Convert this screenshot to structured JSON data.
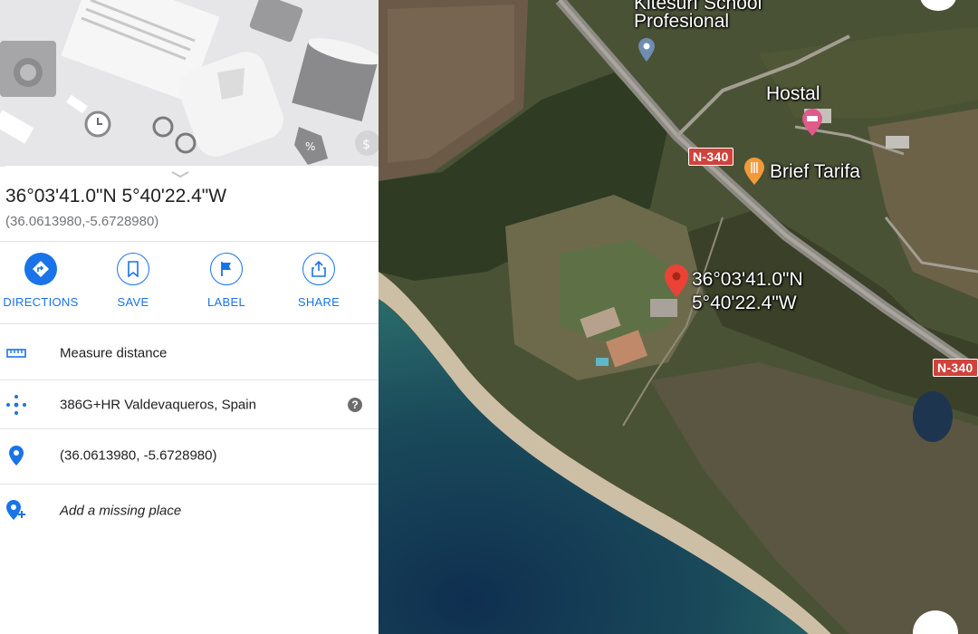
{
  "place": {
    "title": "36°03'41.0\"N 5°40'22.4\"W",
    "decimal": "(36.0613980,-5.6728980)"
  },
  "actions": [
    {
      "label": "DIRECTIONS",
      "icon": "directions-icon"
    },
    {
      "label": "SAVE",
      "icon": "bookmark-icon"
    },
    {
      "label": "LABEL",
      "icon": "flag-icon"
    },
    {
      "label": "SHARE",
      "icon": "share-icon"
    }
  ],
  "details": {
    "measure": "Measure distance",
    "plus_code": "386G+HR Valdevaqueros, Spain",
    "coords": "(36.0613980, -5.6728980)",
    "add_place": "Add a missing place"
  },
  "map": {
    "school_partial": "Kitesurf School",
    "school_line2": "Profesional",
    "hostal": "Hostal",
    "restaurant": "Brief Tarifa",
    "road": "N-340",
    "road2": "N-340",
    "pin_lat": "36°03'41.0\"N",
    "pin_lng": "5°40'22.4\"W"
  },
  "colors": {
    "accent": "#1a73e8",
    "pin": "#ea4335",
    "road_shield": "#d0423b"
  }
}
